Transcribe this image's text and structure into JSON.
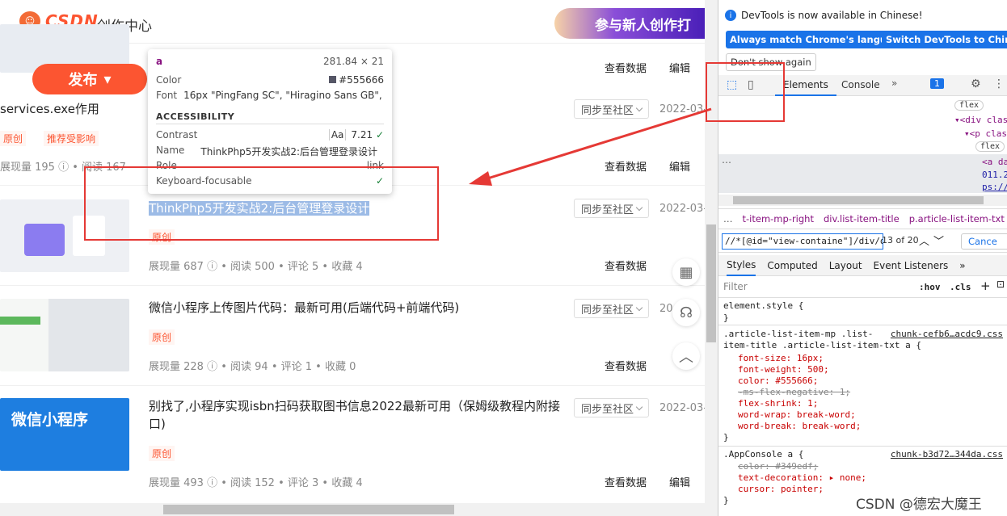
{
  "header": {
    "logo": "CSDN",
    "logo_mark": "☺",
    "title": "创作中心",
    "banner": "参与新人创作打"
  },
  "publish": {
    "label": "发布",
    "arrow": "▾"
  },
  "ops": {
    "view_data": "查看数据",
    "edit": "编辑"
  },
  "sync_label": "同步至社区",
  "items": [
    {
      "title": "services.exe作用",
      "tags": [
        "原创",
        "推荐受影响"
      ],
      "stats": "展现量 195 ⓘ  • 阅读 167",
      "date": "2022-03-"
    },
    {
      "title": "ThinkPhp5开发实战2:后台管理登录设计",
      "tags": [
        "原创"
      ],
      "stats": "展现量 687 ⓘ  • 阅读 500  • 评论 5  • 收藏 4",
      "date": "2022-03-"
    },
    {
      "title": "微信小程序上传图片代码：最新可用(后端代码+前端代码)",
      "tags": [
        "原创"
      ],
      "stats": "展现量 228 ⓘ  • 阅读 94  • 评论 1  • 收藏 0",
      "date": "20"
    },
    {
      "title": "别找了,小程序实现isbn扫码获取图书信息2022最新可用（保姆级教程内附接口)",
      "tags": [
        "原创"
      ],
      "stats": "展现量 493 ⓘ  • 阅读 152  • 评论 3  • 收藏 4",
      "date": "2022-03-",
      "thumb_text": "微信小程序"
    }
  ],
  "tooltip": {
    "tag": "a",
    "size": "281.84 × 21",
    "color_label": "Color",
    "color_value": "#555666",
    "font_label": "Font",
    "font_value": "16px \"PingFang SC\", \"Hiragino Sans GB\", …",
    "section": "ACCESSIBILITY",
    "contrast_label": "Contrast",
    "contrast_value": "7.21",
    "name_label": "Name",
    "name_value": "ThinkPhp5开发实战2:后台管理登录设计",
    "role_label": "Role",
    "role_value": "link",
    "kb_label": "Keyboard-focusable",
    "aa": "Aa"
  },
  "devtools": {
    "notice": "DevTools is now available in Chinese!",
    "btn_match": "Always match Chrome's language",
    "btn_switch": "Switch DevTools to Chinese",
    "btn_dont": "Don't show again",
    "tab_elements": "Elements",
    "tab_console": "Console",
    "more": "»",
    "issues": "1",
    "dom_lines": [
      "flex",
      "▾<div clas",
      "▾<p clas",
      "flex",
      "<a da",
      "011.2",
      "ps://"
    ],
    "breadcrumbs": [
      "t-item-mp-right",
      "div.list-item-title",
      "p.article-list-item-txt",
      "a"
    ],
    "search_value": "//*[@id=\"view-containe\"]/div/di",
    "search_count": "13 of 20",
    "cancel": "Cance",
    "style_tabs": [
      "Styles",
      "Computed",
      "Layout",
      "Event Listeners",
      "»"
    ],
    "filter_placeholder": "Filter",
    "hov": ":hov",
    "cls": ".cls",
    "rules": {
      "element_style": "element.style {",
      "close": "}",
      "sel1a": ".article-list-item-mp .list-",
      "sel1b": "item-title .article-list-item-txt a {",
      "link1": "chunk-cefb6…acdc9.css",
      "p1": "font-size: 16px;",
      "p2": "font-weight: 500;",
      "p3": "color:  #555666;",
      "p4": "-ms-flex-negative: 1;",
      "p5": "flex-shrink: 1;",
      "p6": "word-wrap: break-word;",
      "p7": "word-break: break-word;",
      "sel2": ".AppConsole a {",
      "link2": "chunk-b3d72…344da.css",
      "q1": "color:  #349edf;",
      "q2": "text-decoration: ▸ none;",
      "q3": "cursor: pointer;"
    }
  },
  "colors": {
    "brand": "#fc5531",
    "devtools_blue": "#1a73e8",
    "selection": "#9cbbe6"
  },
  "watermark": "CSDN @德宏大魔王"
}
